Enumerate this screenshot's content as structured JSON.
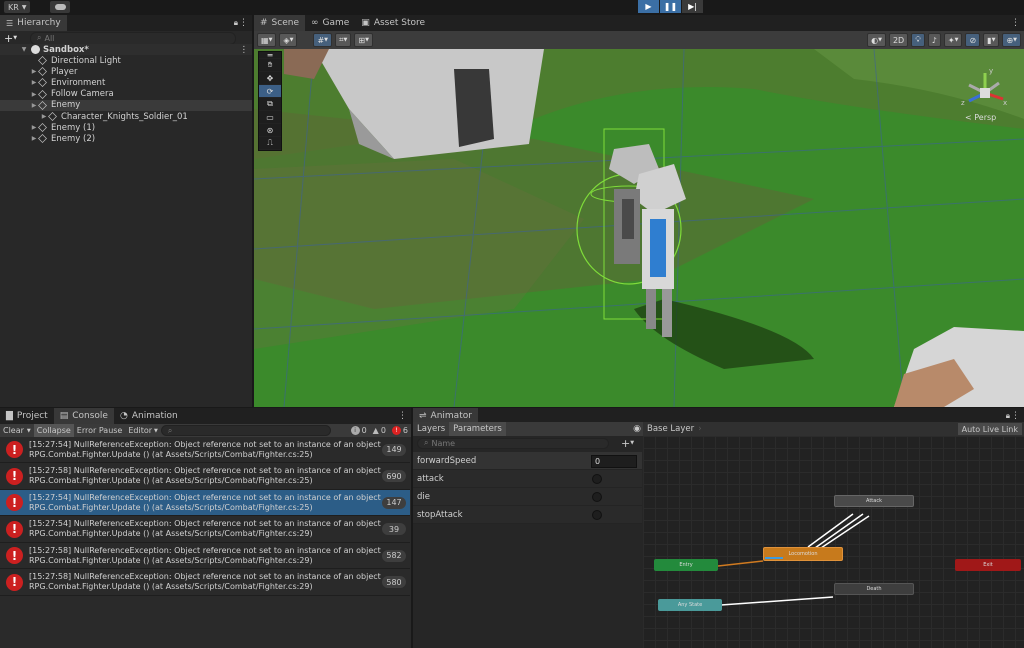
{
  "topbar": {
    "account": "KR"
  },
  "hierarchy": {
    "tab": "Hierarchy",
    "search_placeholder": "All",
    "add_label": "+",
    "scene_name": "Sandbox*",
    "items": [
      {
        "label": "Directional Light",
        "depth": 1,
        "expand": false
      },
      {
        "label": "Player",
        "depth": 1,
        "expand": true
      },
      {
        "label": "Environment",
        "depth": 1,
        "expand": true
      },
      {
        "label": "Follow Camera",
        "depth": 1,
        "expand": true
      },
      {
        "label": "Enemy",
        "depth": 1,
        "expand": true,
        "selected": true
      },
      {
        "label": "Character_Knights_Soldier_01",
        "depth": 2,
        "expand": true
      },
      {
        "label": "Enemy (1)",
        "depth": 1,
        "expand": true
      },
      {
        "label": "Enemy (2)",
        "depth": 1,
        "expand": true
      }
    ]
  },
  "scene": {
    "tabs": [
      "Scene",
      "Game",
      "Asset Store"
    ],
    "btn_2d": "2D",
    "persp": "< Persp",
    "gizmo_axes": {
      "y": "y",
      "x": "x",
      "z": "z"
    }
  },
  "console": {
    "tabs": [
      "Project",
      "Console",
      "Animation"
    ],
    "buttons": {
      "clear": "Clear",
      "collapse": "Collapse",
      "error_pause": "Error Pause",
      "editor": "Editor"
    },
    "counts": {
      "info": "0",
      "warn": "0",
      "error": "6"
    },
    "messages": [
      {
        "line1": "[15:27:54] NullReferenceException: Object reference not set to an instance of an object",
        "line2": "RPG.Combat.Fighter.Update () (at Assets/Scripts/Combat/Fighter.cs:25)",
        "count": "149"
      },
      {
        "line1": "[15:27:58] NullReferenceException: Object reference not set to an instance of an object",
        "line2": "RPG.Combat.Fighter.Update () (at Assets/Scripts/Combat/Fighter.cs:25)",
        "count": "690"
      },
      {
        "line1": "[15:27:54] NullReferenceException: Object reference not set to an instance of an object",
        "line2": "RPG.Combat.Fighter.Update () (at Assets/Scripts/Combat/Fighter.cs:25)",
        "count": "147",
        "selected": true
      },
      {
        "line1": "[15:27:54] NullReferenceException: Object reference not set to an instance of an object",
        "line2": "RPG.Combat.Fighter.Update () (at Assets/Scripts/Combat/Fighter.cs:29)",
        "count": "39"
      },
      {
        "line1": "[15:27:58] NullReferenceException: Object reference not set to an instance of an object",
        "line2": "RPG.Combat.Fighter.Update () (at Assets/Scripts/Combat/Fighter.cs:29)",
        "count": "582"
      },
      {
        "line1": "[15:27:58] NullReferenceException: Object reference not set to an instance of an object",
        "line2": "RPG.Combat.Fighter.Update () (at Assets/Scripts/Combat/Fighter.cs:29)",
        "count": "580"
      }
    ]
  },
  "animator": {
    "tab": "Animator",
    "subtabs": [
      "Layers",
      "Parameters"
    ],
    "search_placeholder": "Name",
    "layer": "Base Layer",
    "auto_live": "Auto Live Link",
    "params": [
      {
        "name": "forwardSpeed",
        "type": "float",
        "value": "0"
      },
      {
        "name": "attack",
        "type": "trigger"
      },
      {
        "name": "die",
        "type": "trigger"
      },
      {
        "name": "stopAttack",
        "type": "trigger"
      }
    ],
    "nodes": {
      "attack": "Attack",
      "locomotion": "Locomotion",
      "entry": "Entry",
      "exit": "Exit",
      "death": "Death",
      "any_state": "Any State"
    }
  }
}
